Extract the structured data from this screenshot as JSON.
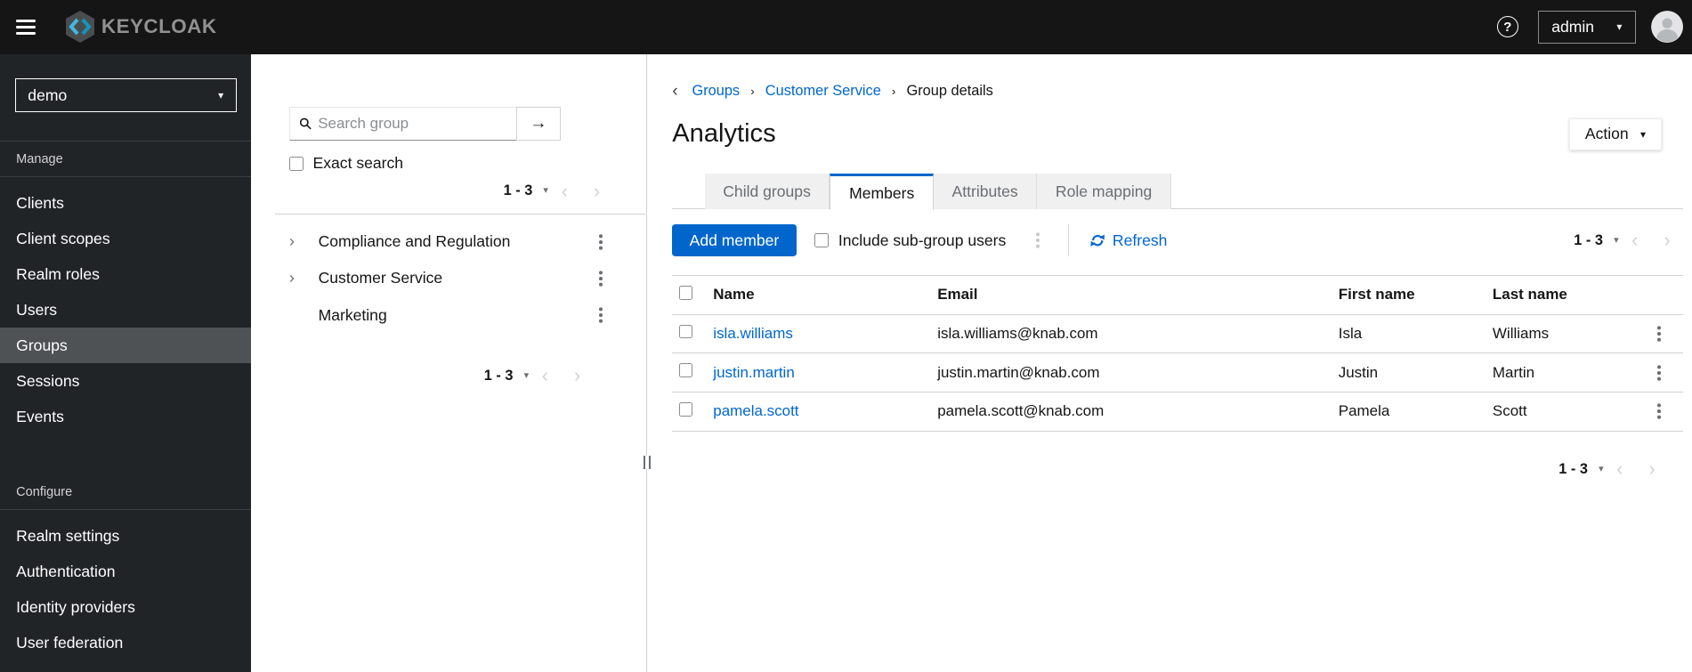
{
  "topbar": {
    "brand": "KEYCLOAK",
    "user_menu_label": "admin"
  },
  "sidebar": {
    "realm_selector": "demo",
    "sections": [
      {
        "label": "Manage",
        "items": [
          {
            "label": "Clients",
            "selected": false
          },
          {
            "label": "Client scopes",
            "selected": false
          },
          {
            "label": "Realm roles",
            "selected": false
          },
          {
            "label": "Users",
            "selected": false
          },
          {
            "label": "Groups",
            "selected": true
          },
          {
            "label": "Sessions",
            "selected": false
          },
          {
            "label": "Events",
            "selected": false
          }
        ]
      },
      {
        "label": "Configure",
        "items": [
          {
            "label": "Realm settings",
            "selected": false
          },
          {
            "label": "Authentication",
            "selected": false
          },
          {
            "label": "Identity providers",
            "selected": false
          },
          {
            "label": "User federation",
            "selected": false
          }
        ]
      }
    ]
  },
  "group_tree_panel": {
    "search_placeholder": "Search group",
    "exact_search_label": "Exact search",
    "pagination_top": "1 - 3",
    "pagination_bottom": "1 - 3",
    "groups": [
      {
        "label": "Compliance and Regulation",
        "expandable": true
      },
      {
        "label": "Customer Service",
        "expandable": true
      },
      {
        "label": "Marketing",
        "expandable": false
      }
    ]
  },
  "main": {
    "breadcrumb": {
      "items": [
        {
          "label": "Groups",
          "link": true
        },
        {
          "label": "Customer Service",
          "link": true
        },
        {
          "label": "Group details",
          "link": false
        }
      ]
    },
    "page_title": "Analytics",
    "action_button_label": "Action",
    "tabs": [
      {
        "label": "Child groups",
        "active": false
      },
      {
        "label": "Members",
        "active": true
      },
      {
        "label": "Attributes",
        "active": false
      },
      {
        "label": "Role mapping",
        "active": false
      }
    ],
    "toolbar": {
      "add_member_label": "Add member",
      "include_subgroups_label": "Include sub-group users",
      "refresh_label": "Refresh",
      "pagination": "1 - 3"
    },
    "members_table": {
      "headers": [
        "Name",
        "Email",
        "First name",
        "Last name"
      ],
      "rows": [
        {
          "name": "isla.williams",
          "email": "isla.williams@knab.com",
          "first_name": "Isla",
          "last_name": "Williams"
        },
        {
          "name": "justin.martin",
          "email": "justin.martin@knab.com",
          "first_name": "Justin",
          "last_name": "Martin"
        },
        {
          "name": "pamela.scott",
          "email": "pamela.scott@knab.com",
          "first_name": "Pamela",
          "last_name": "Scott"
        }
      ]
    },
    "pagination_bottom": "1 - 3"
  },
  "icons": {
    "help": "?",
    "caret_down": "▾",
    "chevron_right": "›",
    "chevron_left": "‹",
    "arrow_right": "→",
    "kebab": "vertical-dots-css-shape",
    "hamburger": "three-bars-css-shape",
    "search": "magnifier-svg",
    "refresh": "sync-arrows-svg",
    "avatar": "person-silhouette-svg",
    "keycloak_logo": "hexagon-chevrons-svg"
  },
  "colors": {
    "accent": "#0066cc",
    "link": "#0066cc",
    "topbar_bg": "#151515",
    "sidebar_bg": "#212427",
    "sidebar_selected_bg": "#4f5255",
    "tab_inactive_bg": "#f0f0f0",
    "border": "#d2d2d2",
    "logo_cyan_light": "#41b9e0",
    "logo_cyan_dark": "#1593bc"
  }
}
